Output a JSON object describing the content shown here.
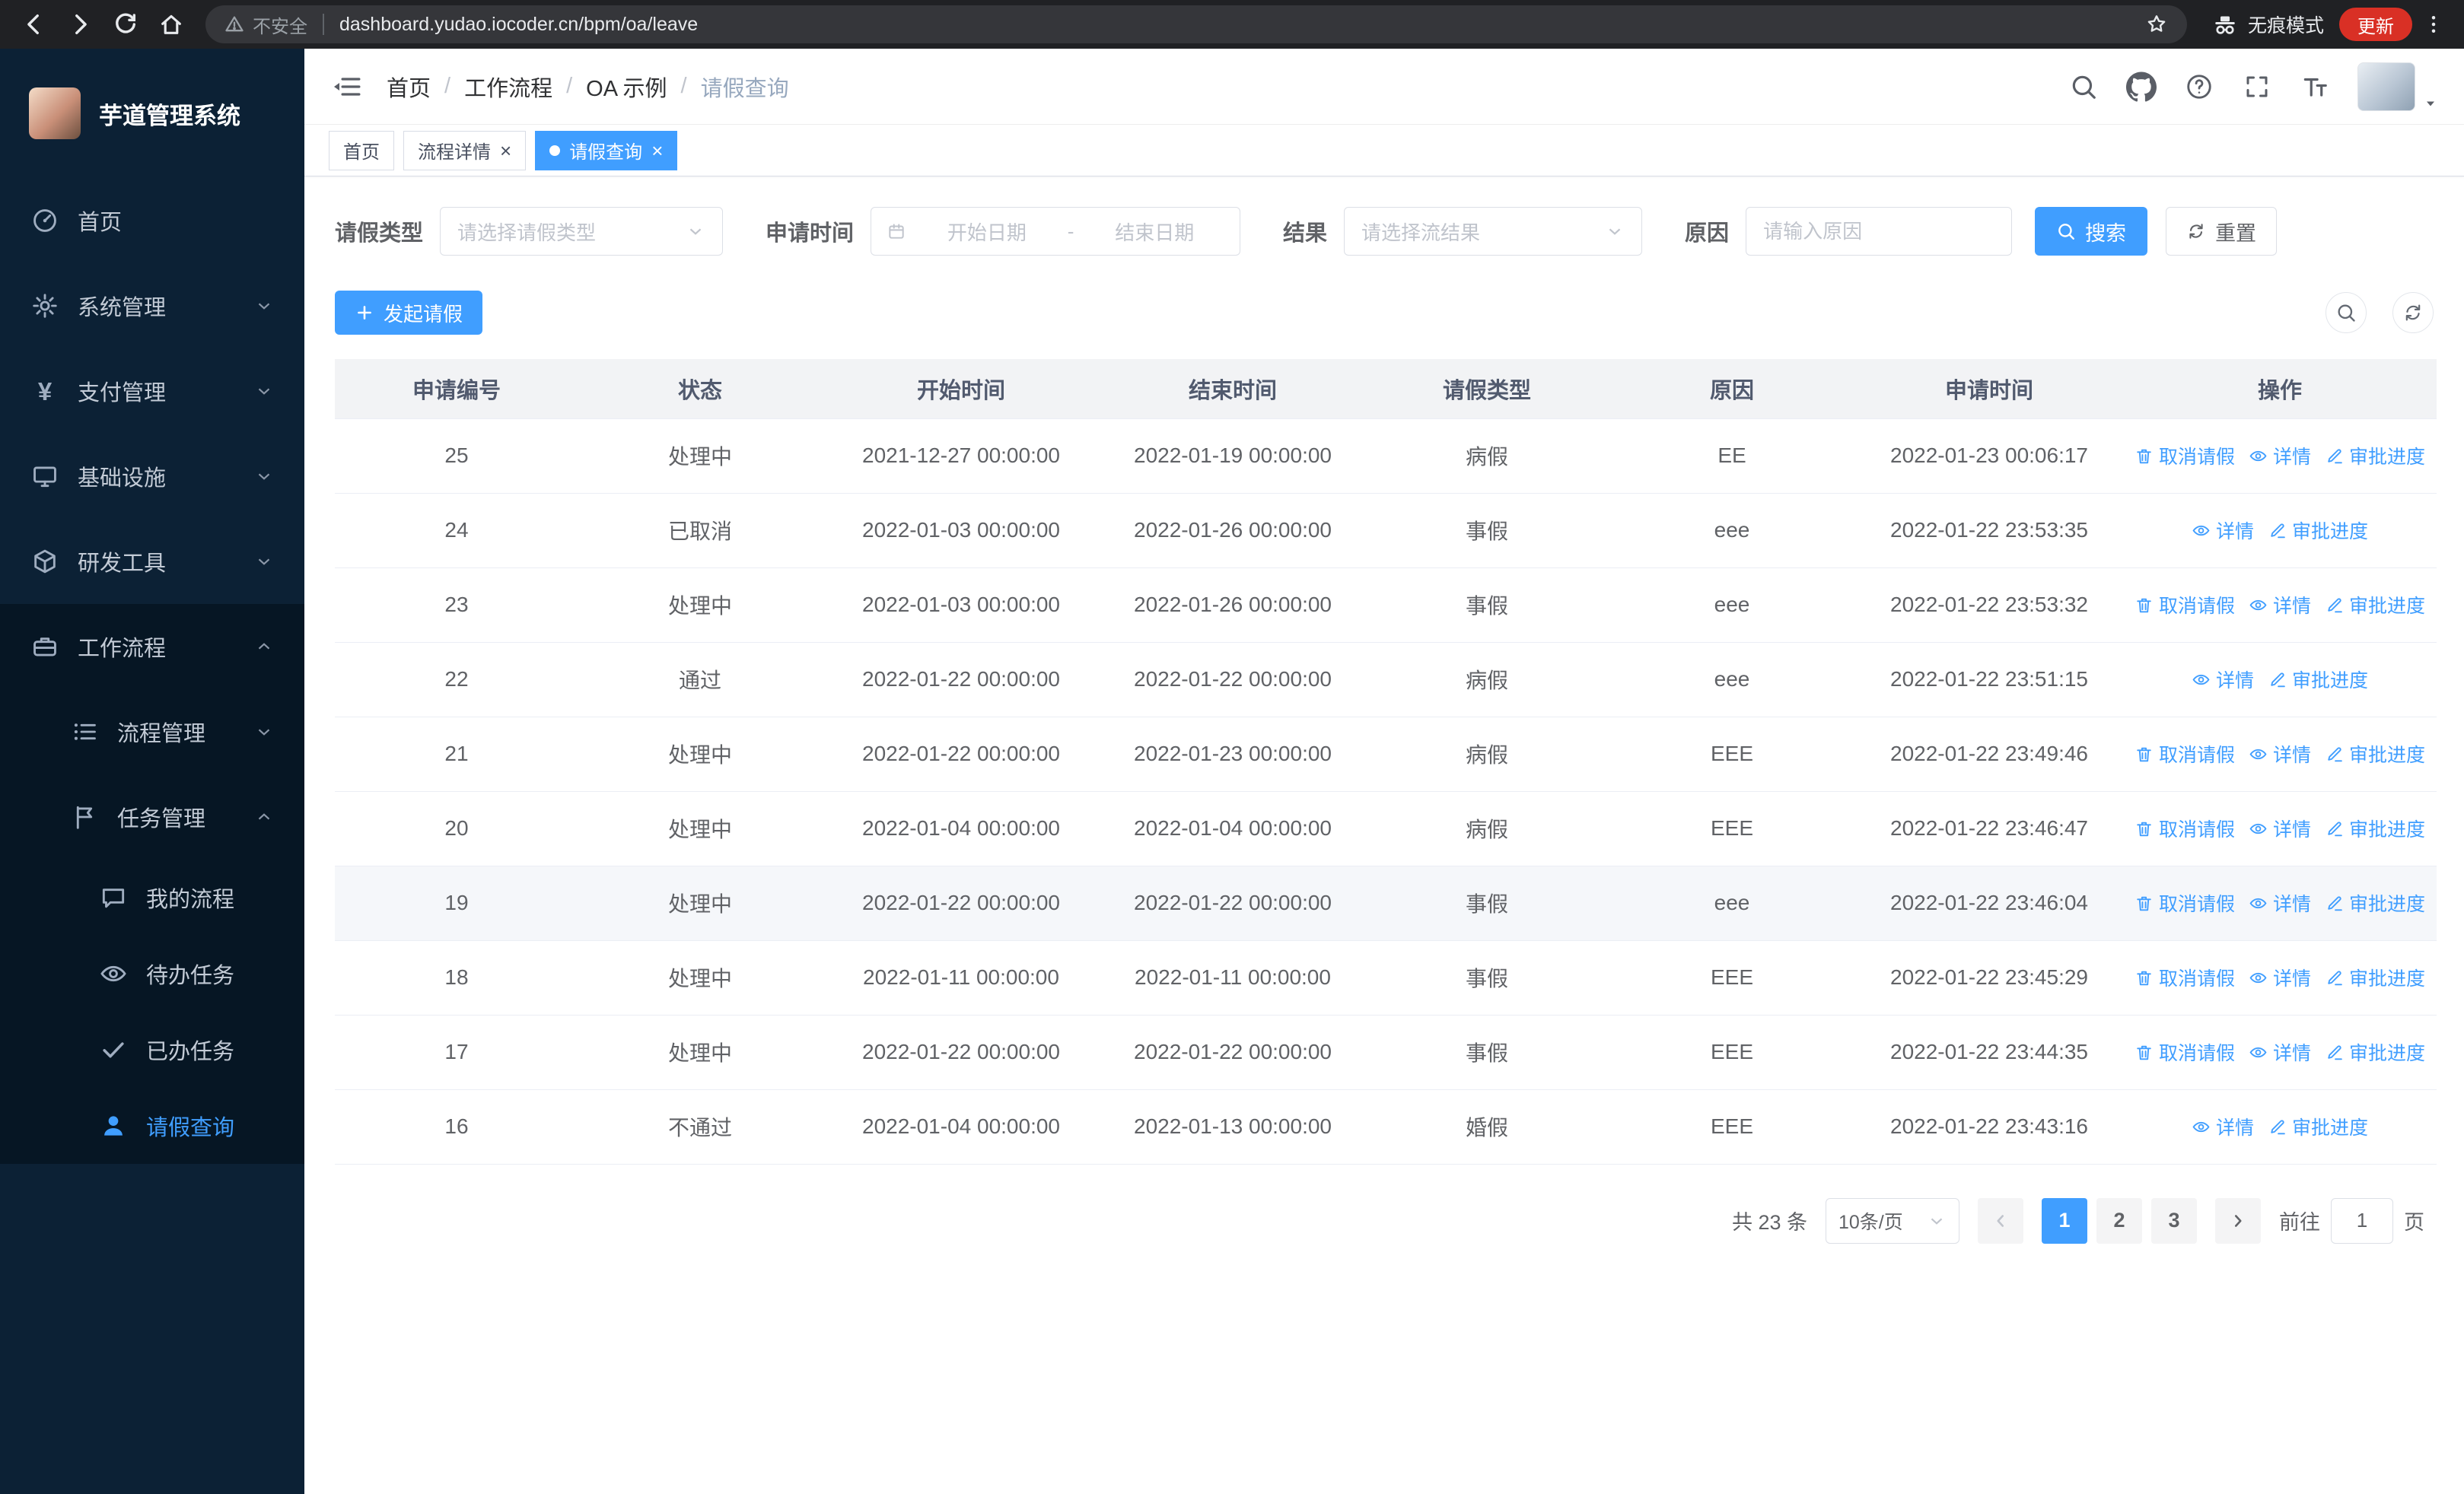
{
  "colors": {
    "accent": "#409eff",
    "sidebar_bg": "#0c2135",
    "submenu_bg": "#061624",
    "chrome_bg": "#202124",
    "update_badge": "#d93025"
  },
  "browser": {
    "security_label": "不安全",
    "url": "dashboard.yudao.iocoder.cn/bpm/oa/leave",
    "incognito_label": "无痕模式",
    "update_label": "更新"
  },
  "sidebar": {
    "title": "芋道管理系统",
    "items": {
      "home": "首页",
      "system": "系统管理",
      "payment": "支付管理",
      "infra": "基础设施",
      "dev": "研发工具",
      "workflow": "工作流程",
      "process": "流程管理",
      "task": "任务管理",
      "my_process": "我的流程",
      "todo": "待办任务",
      "done": "已办任务",
      "leave": "请假查询"
    }
  },
  "header": {
    "breadcrumb": [
      "首页",
      "工作流程",
      "OA 示例",
      "请假查询"
    ],
    "breadcrumb_separator": "/"
  },
  "tabs": [
    {
      "label": "首页",
      "closable": false,
      "active": false
    },
    {
      "label": "流程详情",
      "closable": true,
      "active": false
    },
    {
      "label": "请假查询",
      "closable": true,
      "active": true
    }
  ],
  "filters": {
    "leave_type_label": "请假类型",
    "leave_type_placeholder": "请选择请假类型",
    "apply_time_label": "申请时间",
    "start_date_placeholder": "开始日期",
    "range_separator": "-",
    "end_date_placeholder": "结束日期",
    "result_label": "结果",
    "result_placeholder": "请选择流结果",
    "reason_label": "原因",
    "reason_placeholder": "请输入原因",
    "search_button": "搜索",
    "reset_button": "重置"
  },
  "toolbar": {
    "create_button": "发起请假"
  },
  "icons": {
    "op_cancel": "trash",
    "op_detail": "eye",
    "op_progress": "edit-pen",
    "toolbar_right": [
      "magnifier",
      "refresh"
    ]
  },
  "table": {
    "columns": [
      "申请编号",
      "状态",
      "开始时间",
      "结束时间",
      "请假类型",
      "原因",
      "申请时间",
      "操作"
    ],
    "col_keys": [
      "id",
      "status",
      "start",
      "end",
      "type",
      "reason",
      "apply_time"
    ],
    "op_labels": {
      "cancel": "取消请假",
      "detail": "详情",
      "progress": "审批进度"
    },
    "rows": [
      {
        "id": "25",
        "status": "处理中",
        "start": "2021-12-27 00:00:00",
        "end": "2022-01-19 00:00:00",
        "type": "病假",
        "reason": "EE",
        "apply_time": "2022-01-23 00:06:17",
        "ops": [
          "cancel",
          "detail",
          "progress"
        ],
        "highlight": false
      },
      {
        "id": "24",
        "status": "已取消",
        "start": "2022-01-03 00:00:00",
        "end": "2022-01-26 00:00:00",
        "type": "事假",
        "reason": "eee",
        "apply_time": "2022-01-22 23:53:35",
        "ops": [
          "detail",
          "progress"
        ],
        "highlight": false
      },
      {
        "id": "23",
        "status": "处理中",
        "start": "2022-01-03 00:00:00",
        "end": "2022-01-26 00:00:00",
        "type": "事假",
        "reason": "eee",
        "apply_time": "2022-01-22 23:53:32",
        "ops": [
          "cancel",
          "detail",
          "progress"
        ],
        "highlight": false
      },
      {
        "id": "22",
        "status": "通过",
        "start": "2022-01-22 00:00:00",
        "end": "2022-01-22 00:00:00",
        "type": "病假",
        "reason": "eee",
        "apply_time": "2022-01-22 23:51:15",
        "ops": [
          "detail",
          "progress"
        ],
        "highlight": false
      },
      {
        "id": "21",
        "status": "处理中",
        "start": "2022-01-22 00:00:00",
        "end": "2022-01-23 00:00:00",
        "type": "病假",
        "reason": "EEE",
        "apply_time": "2022-01-22 23:49:46",
        "ops": [
          "cancel",
          "detail",
          "progress"
        ],
        "highlight": false
      },
      {
        "id": "20",
        "status": "处理中",
        "start": "2022-01-04 00:00:00",
        "end": "2022-01-04 00:00:00",
        "type": "病假",
        "reason": "EEE",
        "apply_time": "2022-01-22 23:46:47",
        "ops": [
          "cancel",
          "detail",
          "progress"
        ],
        "highlight": false
      },
      {
        "id": "19",
        "status": "处理中",
        "start": "2022-01-22 00:00:00",
        "end": "2022-01-22 00:00:00",
        "type": "事假",
        "reason": "eee",
        "apply_time": "2022-01-22 23:46:04",
        "ops": [
          "cancel",
          "detail",
          "progress"
        ],
        "highlight": true
      },
      {
        "id": "18",
        "status": "处理中",
        "start": "2022-01-11 00:00:00",
        "end": "2022-01-11 00:00:00",
        "type": "事假",
        "reason": "EEE",
        "apply_time": "2022-01-22 23:45:29",
        "ops": [
          "cancel",
          "detail",
          "progress"
        ],
        "highlight": false
      },
      {
        "id": "17",
        "status": "处理中",
        "start": "2022-01-22 00:00:00",
        "end": "2022-01-22 00:00:00",
        "type": "事假",
        "reason": "EEE",
        "apply_time": "2022-01-22 23:44:35",
        "ops": [
          "cancel",
          "detail",
          "progress"
        ],
        "highlight": false
      },
      {
        "id": "16",
        "status": "不通过",
        "start": "2022-01-04 00:00:00",
        "end": "2022-01-13 00:00:00",
        "type": "婚假",
        "reason": "EEE",
        "apply_time": "2022-01-22 23:43:16",
        "ops": [
          "detail",
          "progress"
        ],
        "highlight": false
      }
    ]
  },
  "pagination": {
    "total_text": "共 23 条",
    "page_size": "10条/页",
    "pages": [
      "1",
      "2",
      "3"
    ],
    "active_page": "1",
    "goto_label": "前往",
    "goto_value": "1",
    "goto_suffix": "页"
  }
}
